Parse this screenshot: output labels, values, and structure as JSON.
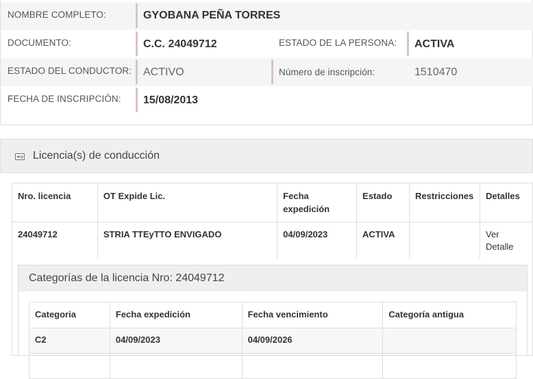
{
  "person": {
    "nombre_label": "NOMBRE COMPLETO:",
    "nombre_value": "GYOBANA PEÑA TORRES",
    "documento_label": "DOCUMENTO:",
    "documento_value": "C.C. 24049712",
    "estado_persona_label": "ESTADO DE LA PERSONA:",
    "estado_persona_value": "ACTIVA",
    "estado_conductor_label": "ESTADO DEL CONDUCTOR:",
    "estado_conductor_value": "ACTIVO",
    "numero_inscripcion_label": "Número de inscripción:",
    "numero_inscripcion_value": "1510470",
    "fecha_inscripcion_label": "FECHA DE INSCRIPCIÓN:",
    "fecha_inscripcion_value": "15/08/2013"
  },
  "licencias": {
    "title": "Licencia(s) de conducción",
    "icon": "id-card-icon",
    "headers": [
      "Nro. licencia",
      "OT Expide Lic.",
      "Fecha expedición",
      "Estado",
      "Restricciones",
      "Detalles"
    ],
    "rows": [
      {
        "nro": "24049712",
        "ot": "STRIA TTEyTTO ENVIGADO",
        "fecha": "04/09/2023",
        "estado": "ACTIVA",
        "restricciones": "",
        "detalles": "Ver Detalle"
      }
    ]
  },
  "categorias": {
    "title": "Categorías de la licencia Nro: 24049712",
    "headers": [
      "Categoria",
      "Fecha expedición",
      "Fecha vencimiento",
      "Categoría antigua"
    ],
    "rows": [
      {
        "categoria": "C2",
        "expedicion": "04/09/2023",
        "vencimiento": "04/09/2026",
        "antigua": ""
      }
    ]
  }
}
